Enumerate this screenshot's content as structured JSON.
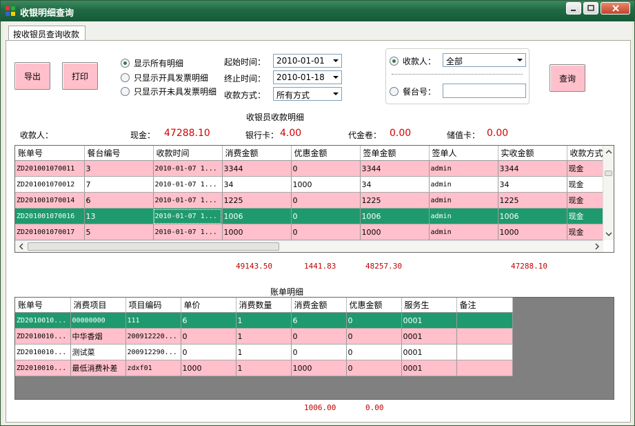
{
  "window": {
    "title": "收银明细查询"
  },
  "tabs": [
    {
      "label": "按收银员查询收款"
    }
  ],
  "toolbar": {
    "export_label": "导出",
    "print_label": "打印",
    "query_label": "查询"
  },
  "filters": {
    "radio_all": "显示所有明细",
    "radio_invoiced": "只显示开具发票明细",
    "radio_not_invoiced": "只显示开未具发票明细",
    "start_label": "起始时间：",
    "start_value": "2010-01-01",
    "end_label": "终止时间：",
    "end_value": "2010-01-18",
    "method_label": "收款方式：",
    "method_value": "所有方式",
    "payee_label": "收款人：",
    "payee_value": "全部",
    "table_no_label": "餐台号："
  },
  "summary": {
    "section_title": "收银员收款明细",
    "payee_label": "收款人：",
    "cash_label": "现金：",
    "cash_value": "47288.10",
    "bank_label": "银行卡：",
    "bank_value": "4.00",
    "voucher_label": "代金卷：",
    "voucher_value": "0.00",
    "stored_label": "储值卡：",
    "stored_value": "0.00"
  },
  "grid1": {
    "columns": [
      "账单号",
      "餐台编号",
      "收款时间",
      "消费金额",
      "优惠金额",
      "签单金额",
      "签单人",
      "实收金额",
      "收款方式"
    ],
    "rows": [
      [
        "ZD201001070011",
        "3",
        "2010-01-07 1...",
        "3344",
        "0",
        "3344",
        "admin",
        "3344",
        "现金"
      ],
      [
        "ZD201001070012",
        "7",
        "2010-01-07 1...",
        "34",
        "1000",
        "34",
        "admin",
        "34",
        "现金"
      ],
      [
        "ZD201001070014",
        "6",
        "2010-01-07 1...",
        "1225",
        "0",
        "1225",
        "admin",
        "1225",
        "现金"
      ],
      [
        "ZD201001070016",
        "13",
        "2010-01-07 1...",
        "1006",
        "0",
        "1006",
        "admin",
        "1006",
        "现金"
      ],
      [
        "ZD201001070017",
        "5",
        "2010-01-07 1...",
        "1000",
        "0",
        "1000",
        "admin",
        "1000",
        "现金"
      ]
    ],
    "totals": {
      "consume": "49143.50",
      "discount": "1441.83",
      "signed": "48257.30",
      "received": "47288.10"
    }
  },
  "grid2": {
    "section_title": "账单明细",
    "columns": [
      "账单号",
      "消费项目",
      "项目编码",
      "单价",
      "消费数量",
      "消费金额",
      "优惠金额",
      "服务生",
      "备注"
    ],
    "rows": [
      [
        "ZD2010010...",
        "00000000",
        "111",
        "6",
        "1",
        "6",
        "0",
        "0001",
        ""
      ],
      [
        "ZD2010010...",
        "中华香烟",
        "200912220...",
        "0",
        "1",
        "0",
        "0",
        "0001",
        ""
      ],
      [
        "ZD2010010...",
        "测试菜",
        "200912290...",
        "0",
        "1",
        "0",
        "0",
        "0001",
        ""
      ],
      [
        "ZD2010010...",
        "最低消费补差",
        "zdxf01",
        "1000",
        "1",
        "1000",
        "0",
        "0001",
        ""
      ]
    ],
    "totals": {
      "consume": "1006.00",
      "discount": "0.00"
    }
  },
  "colors": {
    "title_bar": "#1f6a45",
    "pink_row": "#ffc0cb",
    "selected_row": "#1f9a6e",
    "amount_red": "#d40000"
  }
}
